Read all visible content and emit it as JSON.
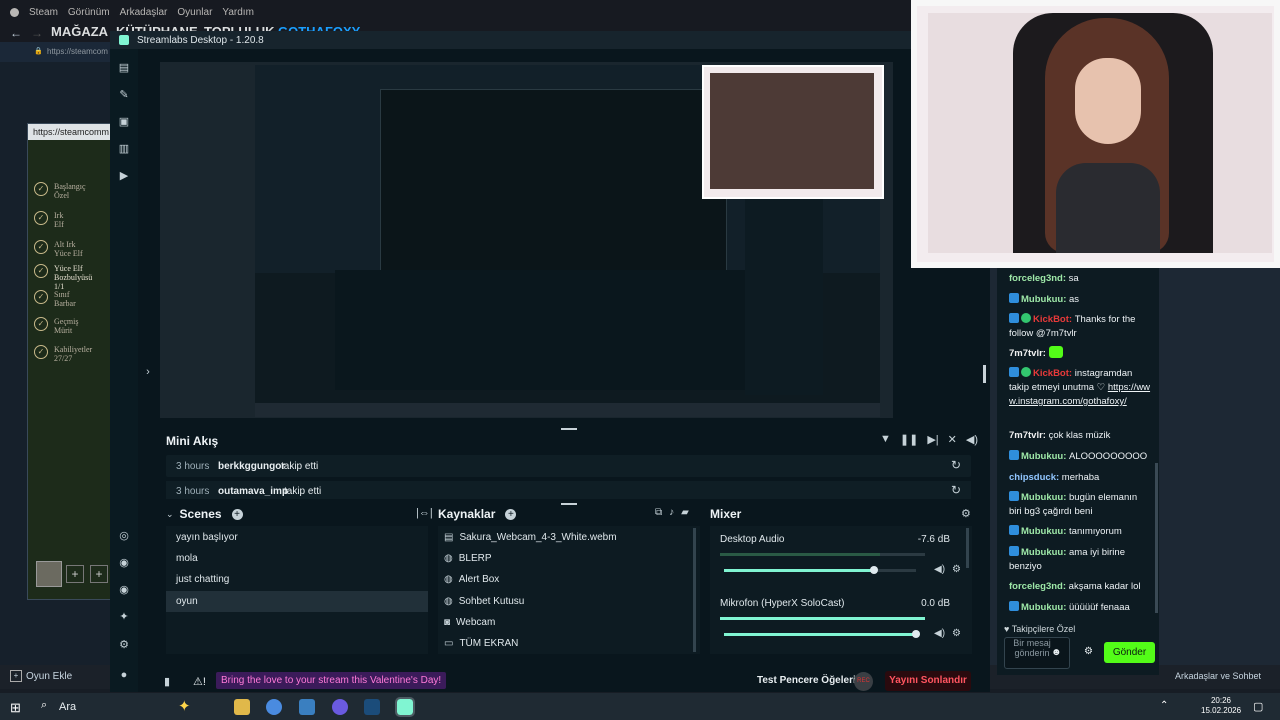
{
  "steam": {
    "menu": [
      "Steam",
      "Görünüm",
      "Arkadaşlar",
      "Oyunlar",
      "Yardım"
    ],
    "nav": [
      "MAĞAZA",
      "KÜTÜPHANE",
      "TOPLULUK",
      "GOTHAFOXY"
    ],
    "url": "https://steamcom",
    "side_url": "https://steamcomm",
    "achievements": [
      {
        "name": "Başlangıç",
        "desc": "Özel"
      },
      {
        "name": "Irk",
        "desc": "Elf"
      },
      {
        "name": "Alt Irk",
        "desc": "Yüce Elf"
      },
      {
        "name": "Yüce Elf Bozbulyüsü",
        "desc": "1/1"
      },
      {
        "name": "Sınıf",
        "desc": "Barbar"
      },
      {
        "name": "Geçmiş",
        "desc": "Mürit"
      },
      {
        "name": "Kabiliyetler",
        "desc": "27/27"
      }
    ],
    "add_game": "Oyun Ekle",
    "friends_chat": "Arkadaşlar ve Sohbet"
  },
  "streamlabs": {
    "title": "Streamlabs Desktop - 1.20.8",
    "mini_feed_title": "Mini Akış",
    "feed": [
      {
        "time": "3 hours",
        "user": "berkkggungor",
        "action": "takip etti"
      },
      {
        "time": "3 hours",
        "user": "outamava_imp",
        "action": "takip etti"
      }
    ],
    "scenes_title": "Scenes",
    "scenes": [
      "yayın başlıyor",
      "mola",
      "just chatting",
      "oyun"
    ],
    "active_scene_index": 3,
    "sources_title": "Kaynaklar",
    "sources": [
      {
        "icon": "file-icon",
        "label": "Sakura_Webcam_4-3_White.webm"
      },
      {
        "icon": "globe-icon",
        "label": "BLERP"
      },
      {
        "icon": "globe-icon",
        "label": "Alert Box"
      },
      {
        "icon": "globe-icon",
        "label": "Sohbet Kutusu"
      },
      {
        "icon": "camera-icon",
        "label": "Webcam"
      },
      {
        "icon": "monitor-icon",
        "label": "TÜM EKRAN"
      }
    ],
    "mixer_title": "Mixer",
    "mixer": [
      {
        "label": "Desktop Audio",
        "value": "-7.6 dB",
        "level": 0.78
      },
      {
        "label": "Mikrofon (HyperX SoloCast)",
        "value": "0.0 dB",
        "level": 1.0
      }
    ],
    "promo": "Bring the love to your stream this Valentine's Day!",
    "test_widgets": "Test Pencere Öğeleri",
    "end_stream": "Yayını Sonlandır",
    "rec_label": "REC"
  },
  "chat": {
    "messages": [
      {
        "user": "forceleg3nd",
        "color": "green",
        "badges": [],
        "text": "sa"
      },
      {
        "user": "Mubukuu",
        "color": "green",
        "badges": [
          "mod"
        ],
        "text": "as"
      },
      {
        "user": "KickBot",
        "color": "red",
        "badges": [
          "mod",
          "verified"
        ],
        "text": "Thanks for the follow @7m7tvlr"
      },
      {
        "user": "7m7tvlr",
        "color": "white",
        "badges": [],
        "text": "(emote)"
      },
      {
        "user": "KickBot",
        "color": "red",
        "badges": [
          "mod",
          "verified"
        ],
        "text": "instagramdan takip etmeyi unutma ♡ https://www.instagram.com/gothafoxy/"
      },
      {
        "user": "7m7tvlr",
        "color": "white",
        "badges": [],
        "text": "çok klas müzik"
      },
      {
        "user": "Mubukuu",
        "color": "green",
        "badges": [
          "mod"
        ],
        "text": "ALOOOOOOOOO"
      },
      {
        "user": "chipsduck",
        "color": "blue",
        "badges": [],
        "text": "merhaba"
      },
      {
        "user": "Mubukuu",
        "color": "green",
        "badges": [
          "mod"
        ],
        "text": "bugün elemanın biri bg3 çağırdı beni"
      },
      {
        "user": "Mubukuu",
        "color": "green",
        "badges": [
          "mod"
        ],
        "text": "tanımıyorum"
      },
      {
        "user": "Mubukuu",
        "color": "green",
        "badges": [
          "mod"
        ],
        "text": "ama iyi birine benziyo"
      },
      {
        "user": "forceleg3nd",
        "color": "green",
        "badges": [],
        "text": "akşama kadar lol"
      },
      {
        "user": "Mubukuu",
        "color": "green",
        "badges": [
          "mod"
        ],
        "text": "üüüüüf fenaaa"
      }
    ],
    "followers_only": "Takipçilere Özel",
    "input_placeholder": "Bir mesaj gönderin",
    "send": "Gönder"
  },
  "taskbar": {
    "search": "Ara",
    "time": "20:26",
    "date": "15.02.2026"
  },
  "colors": {
    "accent_green": "#53fc18",
    "end_red": "#2a0a0e",
    "promo_purple": "#3b1b5a"
  }
}
